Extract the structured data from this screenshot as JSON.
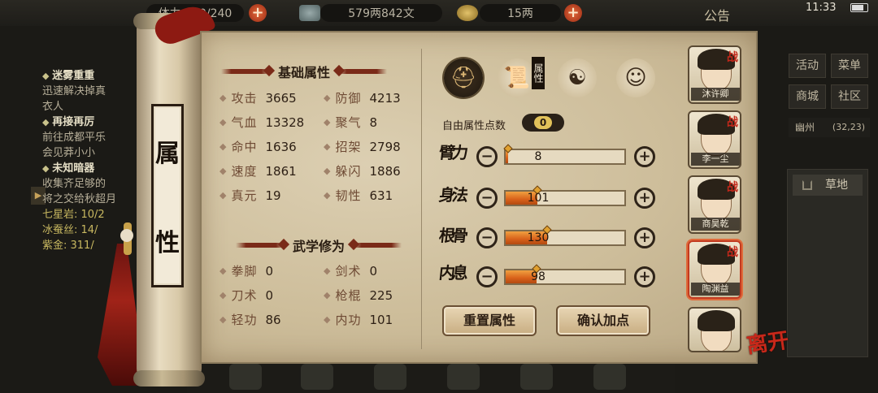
{
  "top_bar": {
    "stamina": "体力 230/240",
    "silver": "579两842文",
    "gold": "15两",
    "notice": "公告",
    "clock": "11:33"
  },
  "quests": [
    {
      "title": "迷雾重重",
      "desc": "迅速解决掉真",
      "desc2": "衣人"
    },
    {
      "title": "再接再厉",
      "desc": "前往成都平乐",
      "desc2": "会见莽小小"
    },
    {
      "title": "未知暗器",
      "desc": "收集齐足够的",
      "desc2": "将之交给秋超月"
    }
  ],
  "left_stats": [
    "七星岩: 10/2",
    "冰蚕丝: 14/",
    "紫金: 311/"
  ],
  "side_menu": {
    "activity": "活动",
    "menu": "菜单",
    "shop": "商城",
    "community": "社区",
    "location": "幽州",
    "coords": "(32,23)",
    "scene": "草地"
  },
  "scroll_title": [
    "属",
    "性"
  ],
  "basic": {
    "header": "基础属性",
    "rows": [
      [
        {
          "label": "攻击",
          "value": "3665"
        },
        {
          "label": "防御",
          "value": "4213"
        }
      ],
      [
        {
          "label": "气血",
          "value": "13328"
        },
        {
          "label": "聚气",
          "value": "8"
        }
      ],
      [
        {
          "label": "命中",
          "value": "1636"
        },
        {
          "label": "招架",
          "value": "2798"
        }
      ],
      [
        {
          "label": "速度",
          "value": "1861"
        },
        {
          "label": "躲闪",
          "value": "1886"
        }
      ],
      [
        {
          "label": "真元",
          "value": "19"
        },
        {
          "label": "韧性",
          "value": "631"
        }
      ]
    ]
  },
  "martial": {
    "header": "武学修为",
    "rows": [
      [
        {
          "label": "拳脚",
          "value": "0"
        },
        {
          "label": "剑术",
          "value": "0"
        }
      ],
      [
        {
          "label": "刀术",
          "value": "0"
        },
        {
          "label": "枪棍",
          "value": "225"
        }
      ],
      [
        {
          "label": "轻功",
          "value": "86"
        },
        {
          "label": "内功",
          "value": "101"
        }
      ]
    ]
  },
  "tabs": {
    "active_tag": "属性",
    "icons": [
      "hat-icon",
      "scroll-tab-icon",
      "bagua-icon",
      "body-icon"
    ]
  },
  "free_points": {
    "label": "自由属性点数",
    "value": "0"
  },
  "attributes": [
    {
      "name": "臂力",
      "value": "8",
      "fill": 0.02
    },
    {
      "name": "身法",
      "value": "101",
      "fill": 0.27
    },
    {
      "name": "根骨",
      "value": "130",
      "fill": 0.35
    },
    {
      "name": "内息",
      "value": "98",
      "fill": 0.26
    }
  ],
  "buttons": {
    "reset": "重置属性",
    "confirm": "确认加点"
  },
  "characters": [
    {
      "name": "沐许卿",
      "tag": "战"
    },
    {
      "name": "李一尘",
      "tag": "战"
    },
    {
      "name": "商昊乾",
      "tag": "战"
    },
    {
      "name": "陶渊益",
      "tag": "战"
    },
    {
      "name": "",
      "tag": ""
    }
  ],
  "leave_label": "离开",
  "colors": {
    "panel": "#cfc0a0",
    "bar_fill": "#d8601a",
    "accent_red": "#c3281a"
  }
}
